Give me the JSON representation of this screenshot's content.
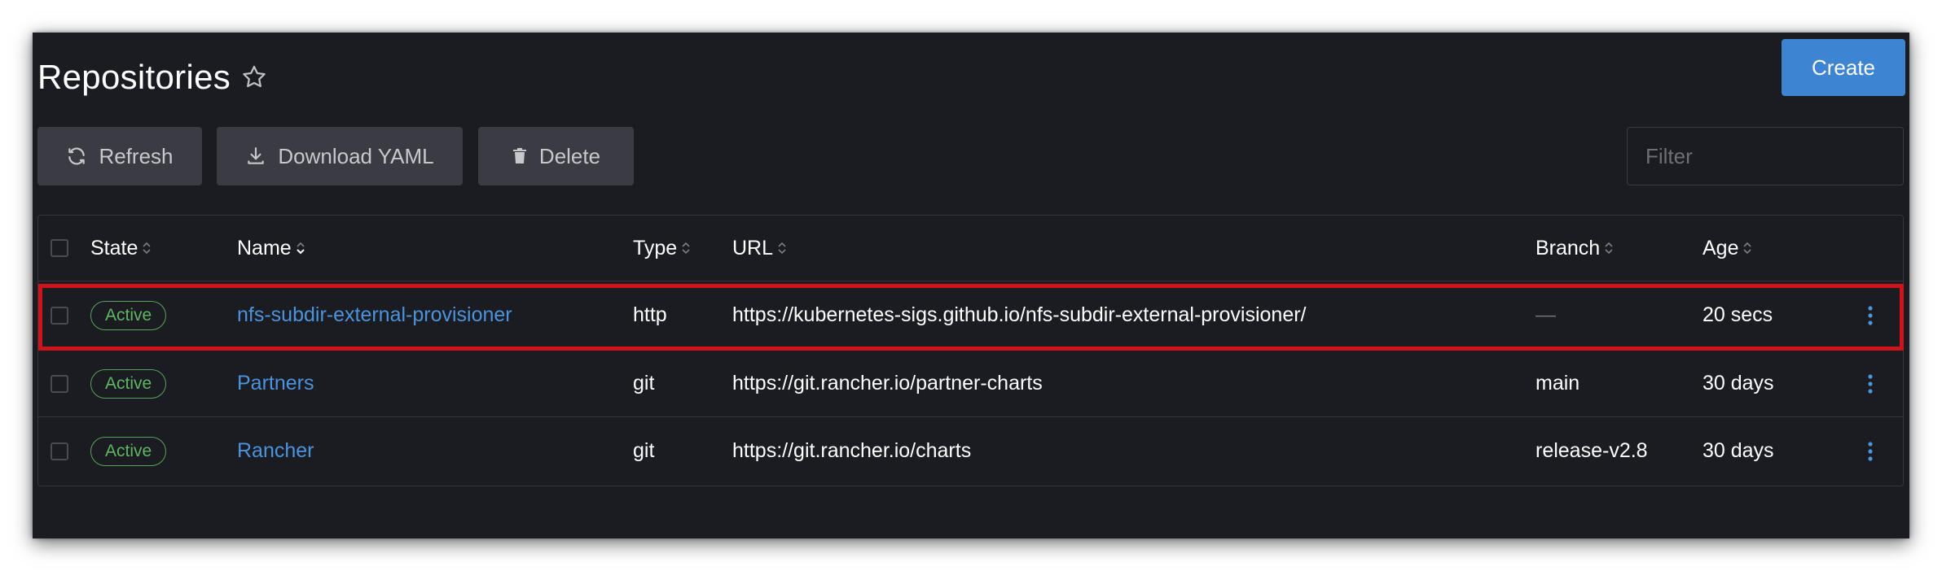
{
  "page": {
    "title": "Repositories",
    "create_label": "Create"
  },
  "toolbar": {
    "refresh_label": "Refresh",
    "download_label": "Download YAML",
    "delete_label": "Delete",
    "filter_placeholder": "Filter"
  },
  "table": {
    "columns": [
      "State",
      "Name",
      "Type",
      "URL",
      "Branch",
      "Age"
    ],
    "rows": [
      {
        "state": "Active",
        "name": "nfs-subdir-external-provisioner",
        "type": "http",
        "url": "https://kubernetes-sigs.github.io/nfs-subdir-external-provisioner/",
        "branch": "—",
        "age": "20 secs"
      },
      {
        "state": "Active",
        "name": "Partners",
        "type": "git",
        "url": "https://git.rancher.io/partner-charts",
        "branch": "main",
        "age": "30 days"
      },
      {
        "state": "Active",
        "name": "Rancher",
        "type": "git",
        "url": "https://git.rancher.io/charts",
        "branch": "release-v2.8",
        "age": "30 days"
      }
    ]
  },
  "colors": {
    "background": "#1b1c21",
    "primary_button": "#3d84d3",
    "link": "#4b93dd",
    "active_badge": "#5fb563",
    "highlight": "#d0121b"
  },
  "icons": {
    "favorite": "star-outline-icon",
    "refresh": "refresh-icon",
    "download": "download-icon",
    "delete": "trash-icon",
    "row_actions": "kebab-menu-icon",
    "sort": "sort-arrows-icon"
  }
}
